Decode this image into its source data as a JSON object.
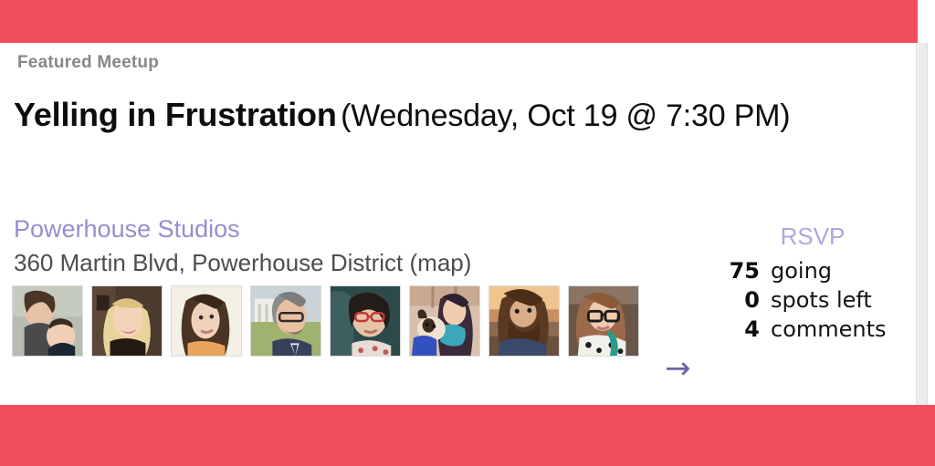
{
  "theme": {
    "accent_red": "#ef4e5a",
    "venue_purple": "#9b8bd0",
    "rsvp_purple": "#b3a4dd",
    "arrow_purple": "#6d62a8",
    "eyebrow_gray": "#878787",
    "address_gray": "#4d4d4d"
  },
  "header": {
    "eyebrow": "Featured Meetup",
    "title": "Yelling in Frustration",
    "when": "(Wednesday, Oct 19 @ 7:30 PM)"
  },
  "location": {
    "venue": "Powerhouse Studios",
    "address": "360 Martin Blvd, Powerhouse District (map)"
  },
  "attendees": {
    "arrow_icon": "→",
    "avatars": [
      {
        "alt": "woman holding baby"
      },
      {
        "alt": "blonde woman smiling"
      },
      {
        "alt": "woman looking sideways"
      },
      {
        "alt": "man with glasses and beard outdoors"
      },
      {
        "alt": "woman with red glasses on train"
      },
      {
        "alt": "woman holding pug dog"
      },
      {
        "alt": "bearded man at sunset"
      },
      {
        "alt": "woman with glasses and teal hair"
      }
    ]
  },
  "rsvp": {
    "title": "RSVP",
    "lines": [
      {
        "count": "75",
        "label": "going"
      },
      {
        "count": "0",
        "label": "spots left"
      },
      {
        "count": "4",
        "label": "comments"
      }
    ]
  }
}
